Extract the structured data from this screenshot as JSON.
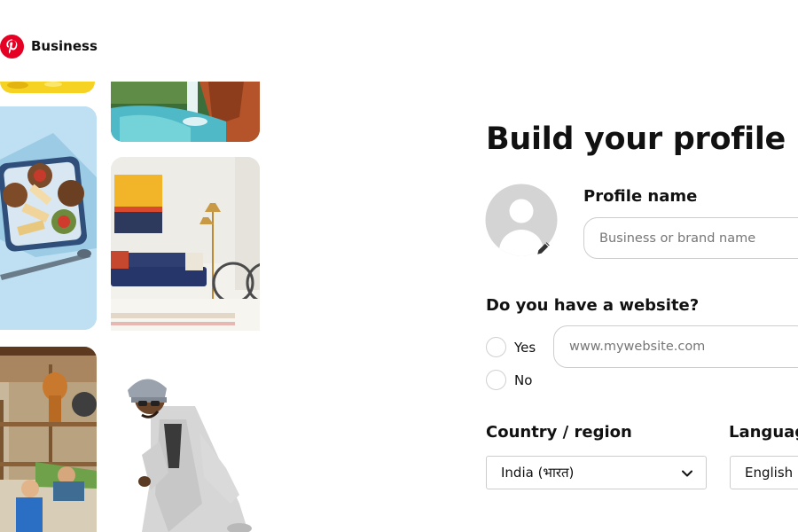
{
  "brand": {
    "label": "Business",
    "logo_icon": "pinterest-logo-icon",
    "color": "#e60023"
  },
  "collage": {
    "tiles": [
      {
        "name": "yellow-pin-image"
      },
      {
        "name": "waterfall-pin-image"
      },
      {
        "name": "food-platter-pin-image"
      },
      {
        "name": "living-room-pin-image"
      },
      {
        "name": "playroom-pin-image"
      },
      {
        "name": "man-in-beanie-pin-image"
      }
    ]
  },
  "form": {
    "title": "Build your profile",
    "avatar_icon": "user-avatar-icon",
    "edit_icon": "pencil-icon",
    "profile_name_label": "Profile name",
    "profile_name_placeholder": "Business or brand name",
    "profile_name_value": "",
    "website_question": "Do you have a website?",
    "website_options": [
      {
        "label": "Yes",
        "selected": false
      },
      {
        "label": "No",
        "selected": false
      }
    ],
    "website_placeholder": "www.mywebsite.com",
    "website_value": "",
    "country_label": "Country / region",
    "country_value": "India (भारत)",
    "language_label": "Languag",
    "language_value": "English ("
  },
  "colors": {
    "text": "#111111",
    "placeholder": "#767676",
    "border": "#cdcdcd",
    "avatar_bg": "#d4d4d4"
  }
}
